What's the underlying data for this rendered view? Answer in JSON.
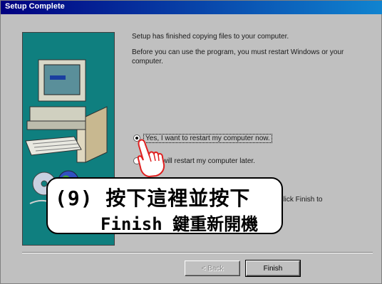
{
  "window": {
    "title": "Setup Complete"
  },
  "main": {
    "message1": "Setup has finished copying files to your computer.",
    "message2": "Before you can use the program, you must restart Windows or your computer.",
    "options": [
      {
        "label": "Yes, I want to restart my computer now.",
        "selected": true
      },
      {
        "label": "No, I will restart my computer later.",
        "selected": false
      }
    ],
    "message3": "hen click Finish to"
  },
  "callout": {
    "line1": "(9) 按下這裡並按下",
    "line2": "Finish 鍵重新開機"
  },
  "buttons": {
    "back_label": "< Back",
    "finish_label": "Finish"
  },
  "colors": {
    "titlebar": "#000080",
    "panel": "#c0c0c0",
    "image_bg": "#008080",
    "callout_bg": "#ffffff"
  }
}
